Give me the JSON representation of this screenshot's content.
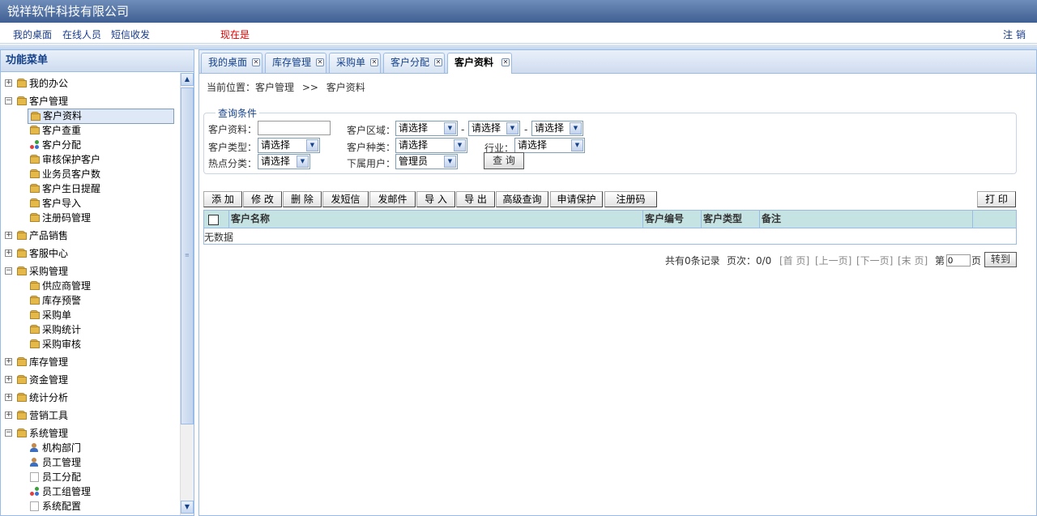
{
  "title": "锐祥软件科技有限公司",
  "nav": {
    "items": [
      "我的桌面",
      "在线人员",
      "短信收发"
    ],
    "now_label": "现在是",
    "logout": "注销"
  },
  "sidebar": {
    "title": "功能菜单",
    "tree": [
      {
        "label": "我的办公",
        "level": 0,
        "expanded": false
      },
      {
        "label": "客户管理",
        "level": 0,
        "expanded": true
      },
      {
        "label": "客户资料",
        "level": 1,
        "selected": true
      },
      {
        "label": "客户查重",
        "level": 1
      },
      {
        "label": "客户分配",
        "level": 1
      },
      {
        "label": "审核保护客户",
        "level": 1
      },
      {
        "label": "业务员客户数",
        "level": 1
      },
      {
        "label": "客户生日提醒",
        "level": 1
      },
      {
        "label": "客户导入",
        "level": 1
      },
      {
        "label": "注册码管理",
        "level": 1
      },
      {
        "label": "产品销售",
        "level": 0,
        "expanded": false
      },
      {
        "label": "客服中心",
        "level": 0,
        "expanded": false
      },
      {
        "label": "采购管理",
        "level": 0,
        "expanded": true
      },
      {
        "label": "供应商管理",
        "level": 1
      },
      {
        "label": "库存预警",
        "level": 1
      },
      {
        "label": "采购单",
        "level": 1
      },
      {
        "label": "采购统计",
        "level": 1
      },
      {
        "label": "采购审核",
        "level": 1
      },
      {
        "label": "库存管理",
        "level": 0,
        "expanded": false
      },
      {
        "label": "资金管理",
        "level": 0,
        "expanded": false
      },
      {
        "label": "统计分析",
        "level": 0,
        "expanded": false
      },
      {
        "label": "营销工具",
        "level": 0,
        "expanded": false
      },
      {
        "label": "系统管理",
        "level": 0,
        "expanded": true
      },
      {
        "label": "机构部门",
        "level": 1
      },
      {
        "label": "员工管理",
        "level": 1
      },
      {
        "label": "员工分配",
        "level": 1
      },
      {
        "label": "员工组管理",
        "level": 1
      },
      {
        "label": "系统配置",
        "level": 1
      }
    ]
  },
  "tabs": [
    {
      "label": "我的桌面"
    },
    {
      "label": "库存管理"
    },
    {
      "label": "采购单"
    },
    {
      "label": "客户分配"
    },
    {
      "label": "客户资料",
      "active": true
    }
  ],
  "breadcrumb": {
    "prefix": "当前位置：客户管理",
    "sep": ">>",
    "current": "客户资料"
  },
  "query": {
    "legend": "查询条件",
    "customer_info_label": "客户资料：",
    "customer_info_value": "",
    "region_label": "客户区域：",
    "region1": "请选择",
    "region2": "请选择",
    "region3": "请选择",
    "type_label": "客户类型：",
    "type_value": "请选择",
    "kind_label": "客户种类：",
    "kind_value": "请选择",
    "industry_label": "行业：",
    "industry_value": "请选择",
    "hot_label": "热点分类：",
    "hot_value": "请选择",
    "user_label": "下属用户：",
    "user_value": "管理员",
    "search_button": "查 询",
    "dash": "-"
  },
  "toolbar": {
    "add": "添 加",
    "edit": "修 改",
    "delete": "删 除",
    "sms": "发短信",
    "mail": "发邮件",
    "import": "导 入",
    "export": "导 出",
    "advanced": "高级查询",
    "protect": "申请保护",
    "regcode": "注册码",
    "print": "打 印"
  },
  "grid": {
    "columns": [
      "客户名称",
      "客户编号",
      "客户类型",
      "备注"
    ],
    "empty": "无数据"
  },
  "pager": {
    "total": "共有0条记录",
    "pages": "页次：0/0",
    "first": "[首 页]",
    "prev": "[上一页]",
    "next": "[下一页]",
    "last": "[末 页]",
    "page_prefix": "第",
    "page_value": "0",
    "page_suffix": "页",
    "go": "转到"
  }
}
